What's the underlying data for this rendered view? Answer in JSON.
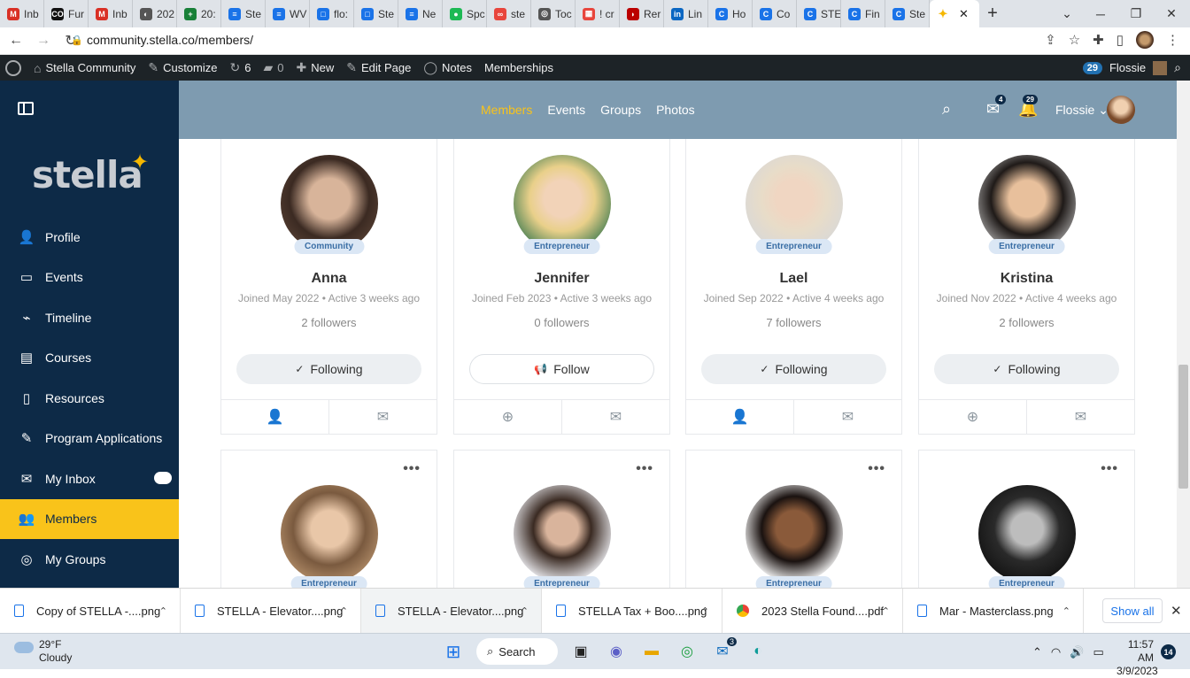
{
  "browser": {
    "tabs": [
      {
        "label": "Inb",
        "fav": "M",
        "color": "#d93025"
      },
      {
        "label": "Fur",
        "fav": "CO",
        "color": "#111"
      },
      {
        "label": "Inb",
        "fav": "M",
        "color": "#d93025"
      },
      {
        "label": "202",
        "fav": "◐",
        "color": "#555"
      },
      {
        "label": "20:",
        "fav": "+",
        "color": "#188038"
      },
      {
        "label": "Ste",
        "fav": "≡",
        "color": "#1a73e8"
      },
      {
        "label": "WV",
        "fav": "≡",
        "color": "#1a73e8"
      },
      {
        "label": "flo:",
        "fav": "□",
        "color": "#1a73e8"
      },
      {
        "label": "Ste",
        "fav": "□",
        "color": "#1a73e8"
      },
      {
        "label": "Ne",
        "fav": "≡",
        "color": "#1a73e8"
      },
      {
        "label": "Spc",
        "fav": "●",
        "color": "#1db954"
      },
      {
        "label": "ste",
        "fav": "∞",
        "color": "#e8453c"
      },
      {
        "label": "Toc",
        "fav": "◎",
        "color": "#555"
      },
      {
        "label": "! cr",
        "fav": "▦",
        "color": "#e8453c"
      },
      {
        "label": "Rer",
        "fav": "◗",
        "color": "#b00"
      },
      {
        "label": "Lin",
        "fav": "in",
        "color": "#0a66c2"
      },
      {
        "label": "Ho",
        "fav": "C",
        "color": "#1a73e8"
      },
      {
        "label": "Co",
        "fav": "C",
        "color": "#1a73e8"
      },
      {
        "label": "STE",
        "fav": "C",
        "color": "#1a73e8"
      },
      {
        "label": "Fin",
        "fav": "C",
        "color": "#1a73e8"
      },
      {
        "label": "Ste",
        "fav": "C",
        "color": "#1a73e8"
      }
    ],
    "active_tab_fav": "✦",
    "url": "community.stella.co/members/"
  },
  "wpbar": {
    "site": "Stella Community",
    "customize": "Customize",
    "updates": "6",
    "comments": "0",
    "new": "New",
    "edit": "Edit Page",
    "notes": "Notes",
    "memberships": "Memberships",
    "badge": "29",
    "user": "Flossie"
  },
  "sidebar": {
    "logo": "stella",
    "items": [
      {
        "label": "Profile",
        "icon": "👤"
      },
      {
        "label": "Events",
        "icon": "▭"
      },
      {
        "label": "Timeline",
        "icon": "⌁"
      },
      {
        "label": "Courses",
        "icon": "▤"
      },
      {
        "label": "Resources",
        "icon": "▯"
      },
      {
        "label": "Program Applications",
        "icon": "✎"
      },
      {
        "label": "My Inbox",
        "icon": "✉"
      },
      {
        "label": "Members",
        "icon": "👥"
      },
      {
        "label": "My Groups",
        "icon": "◎"
      }
    ]
  },
  "topnav": {
    "links": [
      "Members",
      "Events",
      "Groups",
      "Photos"
    ],
    "inbox_count": "4",
    "notif_count": "29",
    "user": "Flossie"
  },
  "members": [
    {
      "role": "Community",
      "name": "Anna",
      "meta": "Joined May 2022  •  Active 3 weeks ago",
      "followers": "2 followers",
      "button": "Following",
      "check": "✓"
    },
    {
      "role": "Entrepreneur",
      "name": "Jennifer",
      "meta": "Joined Feb 2023  •  Active 3 weeks ago",
      "followers": "0 followers",
      "button": "Follow",
      "check": "📢"
    },
    {
      "role": "Entrepreneur",
      "name": "Lael",
      "meta": "Joined Sep 2022  •  Active 4 weeks ago",
      "followers": "7 followers",
      "button": "Following",
      "check": "✓"
    },
    {
      "role": "Entrepreneur",
      "name": "Kristina",
      "meta": "Joined Nov 2022  •  Active 4 weeks ago",
      "followers": "2 followers",
      "button": "Following",
      "check": "✓"
    }
  ],
  "members_row2": [
    {
      "role": "Entrepreneur"
    },
    {
      "role": "Entrepreneur"
    },
    {
      "role": "Entrepreneur"
    },
    {
      "role": "Entrepreneur"
    }
  ],
  "downloads": [
    "Copy of STELLA -....png",
    "STELLA - Elevator....png",
    "STELLA - Elevator....png",
    "STELLA Tax + Boo....png",
    "2023 Stella Found....pdf",
    "Mar - Masterclass.png"
  ],
  "show_all": "Show all",
  "taskbar": {
    "temp": "29°F",
    "cond": "Cloudy",
    "search": "Search",
    "time": "11:57 AM",
    "date": "3/9/2023",
    "notif": "14",
    "mail_badge": "3"
  },
  "colors": {
    "accent": "#f9c31a",
    "sidebar": "#0d2a47",
    "topnav": "#7e9bb0"
  }
}
